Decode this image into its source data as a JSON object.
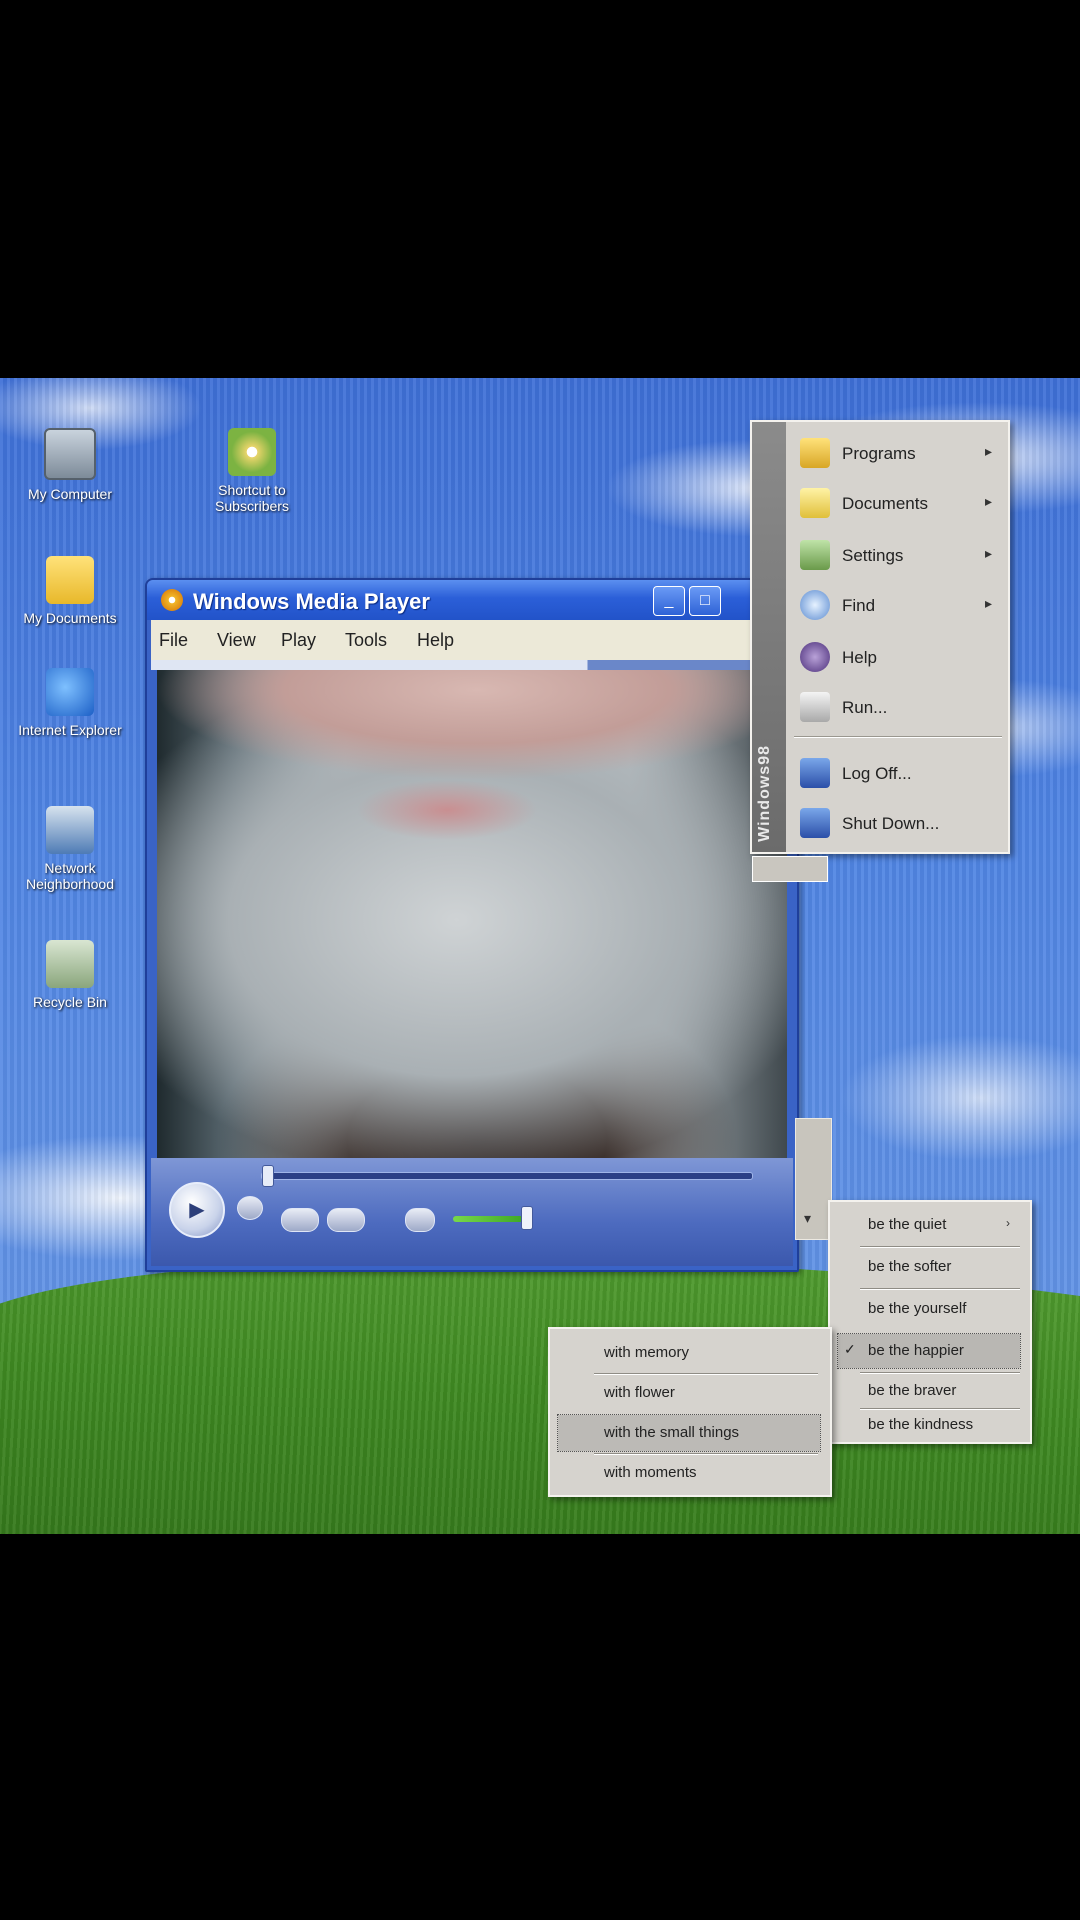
{
  "desktop": {
    "icons": [
      {
        "label": "My Computer",
        "glyph": "computer-icon"
      },
      {
        "label": "Shortcut to Subscribers",
        "glyph": "cd-icon"
      },
      {
        "label": "My Documents",
        "glyph": "folder-icon"
      },
      {
        "label": "Internet Explorer",
        "glyph": "ie-icon"
      },
      {
        "label": "Network Neighborhood",
        "glyph": "network-icon"
      },
      {
        "label": "Recycle Bin",
        "glyph": "recycle-bin-icon"
      }
    ]
  },
  "media_player": {
    "title": "Windows Media Player",
    "menu": [
      "File",
      "View",
      "Play",
      "Tools",
      "Help"
    ],
    "buttons": {
      "play": "▶",
      "minimize": "_",
      "maximize": "□"
    }
  },
  "start_menu": {
    "brand": "Windows98",
    "items": [
      {
        "label": "Programs",
        "submenu": true
      },
      {
        "label": "Documents",
        "submenu": true
      },
      {
        "label": "Settings",
        "submenu": true
      },
      {
        "label": "Find",
        "submenu": true
      },
      {
        "label": "Help",
        "submenu": false
      },
      {
        "label": "Run...",
        "submenu": false
      },
      {
        "label": "Log Off...",
        "submenu": false
      },
      {
        "label": "Shut Down...",
        "submenu": false
      }
    ]
  },
  "submenu_a": {
    "items": [
      {
        "label": "be the quiet",
        "arrow": "›",
        "check": ""
      },
      {
        "label": "be the softer",
        "arrow": "",
        "check": ""
      },
      {
        "label": "be the yourself",
        "arrow": "",
        "check": ""
      },
      {
        "label": "be the happier",
        "arrow": "",
        "check": "✓",
        "highlighted": true
      },
      {
        "label": "be the braver",
        "arrow": "",
        "check": ""
      },
      {
        "label": "be the kindness",
        "arrow": "",
        "check": ""
      }
    ]
  },
  "submenu_b": {
    "items": [
      {
        "label": "with memory",
        "highlighted": false
      },
      {
        "label": "with flower",
        "highlighted": false
      },
      {
        "label": "with the small things",
        "highlighted": true
      },
      {
        "label": "with moments",
        "highlighted": false
      }
    ]
  },
  "colors": {
    "titlebar": "#2b5fd8",
    "menu_bg": "#d6d3ce",
    "sky": "#4f84e3",
    "grass": "#3f8a22"
  }
}
